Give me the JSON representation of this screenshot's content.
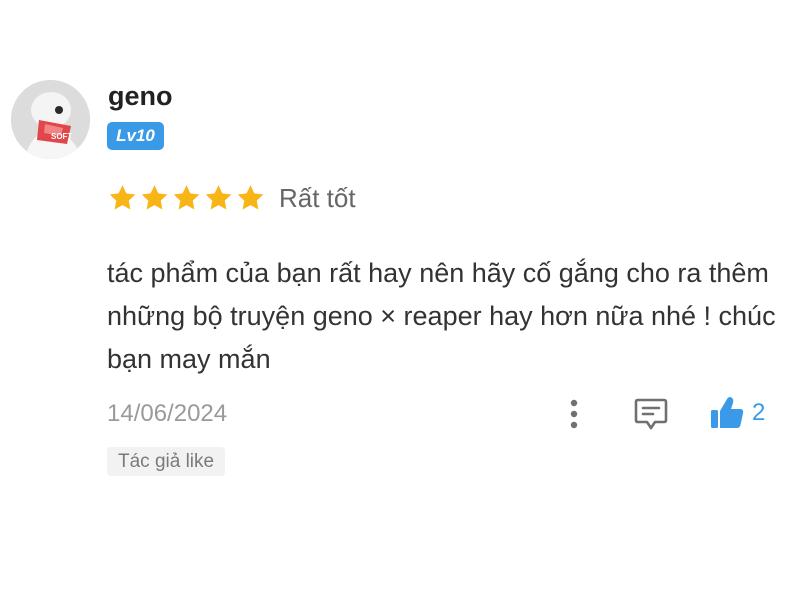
{
  "review": {
    "user": {
      "name": "geno",
      "level": "Lv10",
      "avatar_text": "SOFT"
    },
    "rating": {
      "stars": 5,
      "max_stars": 5,
      "label": "Rất tốt"
    },
    "comment": "tác phẩm của bạn rất hay nên hãy cố gắng cho ra thêm những bộ truyện geno × reaper hay hơn nữa nhé ! chúc bạn may mắn",
    "date": "14/06/2024",
    "actions": {
      "more_icon": "more-vertical-icon",
      "reply_icon": "comment-reply-icon",
      "like_icon": "thumbs-up-icon",
      "like_count": "2"
    },
    "author_tag": "Tác giả like"
  },
  "colors": {
    "star": "#f9b515",
    "accent": "#3b9ae8",
    "icon_gray": "#707070"
  }
}
